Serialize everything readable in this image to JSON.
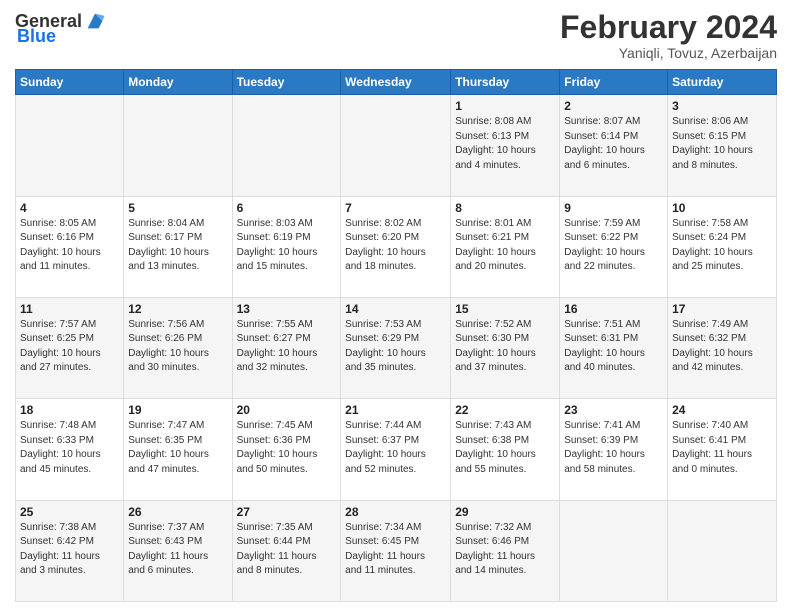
{
  "logo": {
    "text_general": "General",
    "text_blue": "Blue"
  },
  "header": {
    "title": "February 2024",
    "subtitle": "Yaniqli, Tovuz, Azerbaijan"
  },
  "weekdays": [
    "Sunday",
    "Monday",
    "Tuesday",
    "Wednesday",
    "Thursday",
    "Friday",
    "Saturday"
  ],
  "weeks": [
    [
      {
        "day": "",
        "info": ""
      },
      {
        "day": "",
        "info": ""
      },
      {
        "day": "",
        "info": ""
      },
      {
        "day": "",
        "info": ""
      },
      {
        "day": "1",
        "info": "Sunrise: 8:08 AM\nSunset: 6:13 PM\nDaylight: 10 hours\nand 4 minutes."
      },
      {
        "day": "2",
        "info": "Sunrise: 8:07 AM\nSunset: 6:14 PM\nDaylight: 10 hours\nand 6 minutes."
      },
      {
        "day": "3",
        "info": "Sunrise: 8:06 AM\nSunset: 6:15 PM\nDaylight: 10 hours\nand 8 minutes."
      }
    ],
    [
      {
        "day": "4",
        "info": "Sunrise: 8:05 AM\nSunset: 6:16 PM\nDaylight: 10 hours\nand 11 minutes."
      },
      {
        "day": "5",
        "info": "Sunrise: 8:04 AM\nSunset: 6:17 PM\nDaylight: 10 hours\nand 13 minutes."
      },
      {
        "day": "6",
        "info": "Sunrise: 8:03 AM\nSunset: 6:19 PM\nDaylight: 10 hours\nand 15 minutes."
      },
      {
        "day": "7",
        "info": "Sunrise: 8:02 AM\nSunset: 6:20 PM\nDaylight: 10 hours\nand 18 minutes."
      },
      {
        "day": "8",
        "info": "Sunrise: 8:01 AM\nSunset: 6:21 PM\nDaylight: 10 hours\nand 20 minutes."
      },
      {
        "day": "9",
        "info": "Sunrise: 7:59 AM\nSunset: 6:22 PM\nDaylight: 10 hours\nand 22 minutes."
      },
      {
        "day": "10",
        "info": "Sunrise: 7:58 AM\nSunset: 6:24 PM\nDaylight: 10 hours\nand 25 minutes."
      }
    ],
    [
      {
        "day": "11",
        "info": "Sunrise: 7:57 AM\nSunset: 6:25 PM\nDaylight: 10 hours\nand 27 minutes."
      },
      {
        "day": "12",
        "info": "Sunrise: 7:56 AM\nSunset: 6:26 PM\nDaylight: 10 hours\nand 30 minutes."
      },
      {
        "day": "13",
        "info": "Sunrise: 7:55 AM\nSunset: 6:27 PM\nDaylight: 10 hours\nand 32 minutes."
      },
      {
        "day": "14",
        "info": "Sunrise: 7:53 AM\nSunset: 6:29 PM\nDaylight: 10 hours\nand 35 minutes."
      },
      {
        "day": "15",
        "info": "Sunrise: 7:52 AM\nSunset: 6:30 PM\nDaylight: 10 hours\nand 37 minutes."
      },
      {
        "day": "16",
        "info": "Sunrise: 7:51 AM\nSunset: 6:31 PM\nDaylight: 10 hours\nand 40 minutes."
      },
      {
        "day": "17",
        "info": "Sunrise: 7:49 AM\nSunset: 6:32 PM\nDaylight: 10 hours\nand 42 minutes."
      }
    ],
    [
      {
        "day": "18",
        "info": "Sunrise: 7:48 AM\nSunset: 6:33 PM\nDaylight: 10 hours\nand 45 minutes."
      },
      {
        "day": "19",
        "info": "Sunrise: 7:47 AM\nSunset: 6:35 PM\nDaylight: 10 hours\nand 47 minutes."
      },
      {
        "day": "20",
        "info": "Sunrise: 7:45 AM\nSunset: 6:36 PM\nDaylight: 10 hours\nand 50 minutes."
      },
      {
        "day": "21",
        "info": "Sunrise: 7:44 AM\nSunset: 6:37 PM\nDaylight: 10 hours\nand 52 minutes."
      },
      {
        "day": "22",
        "info": "Sunrise: 7:43 AM\nSunset: 6:38 PM\nDaylight: 10 hours\nand 55 minutes."
      },
      {
        "day": "23",
        "info": "Sunrise: 7:41 AM\nSunset: 6:39 PM\nDaylight: 10 hours\nand 58 minutes."
      },
      {
        "day": "24",
        "info": "Sunrise: 7:40 AM\nSunset: 6:41 PM\nDaylight: 11 hours\nand 0 minutes."
      }
    ],
    [
      {
        "day": "25",
        "info": "Sunrise: 7:38 AM\nSunset: 6:42 PM\nDaylight: 11 hours\nand 3 minutes."
      },
      {
        "day": "26",
        "info": "Sunrise: 7:37 AM\nSunset: 6:43 PM\nDaylight: 11 hours\nand 6 minutes."
      },
      {
        "day": "27",
        "info": "Sunrise: 7:35 AM\nSunset: 6:44 PM\nDaylight: 11 hours\nand 8 minutes."
      },
      {
        "day": "28",
        "info": "Sunrise: 7:34 AM\nSunset: 6:45 PM\nDaylight: 11 hours\nand 11 minutes."
      },
      {
        "day": "29",
        "info": "Sunrise: 7:32 AM\nSunset: 6:46 PM\nDaylight: 11 hours\nand 14 minutes."
      },
      {
        "day": "",
        "info": ""
      },
      {
        "day": "",
        "info": ""
      }
    ]
  ]
}
